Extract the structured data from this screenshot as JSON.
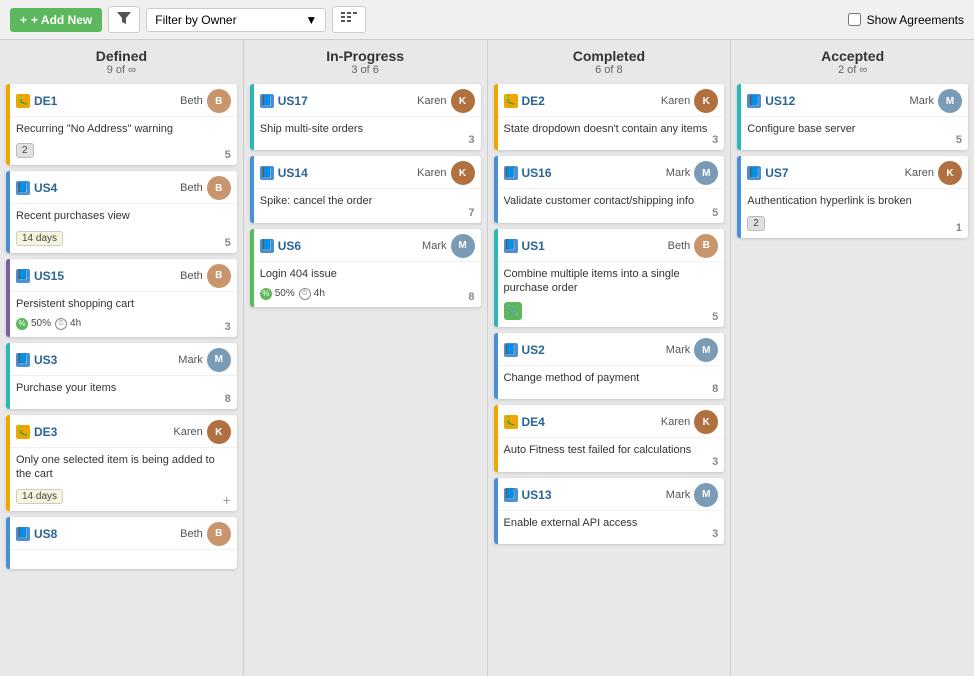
{
  "toolbar": {
    "add_new_label": "+ Add New",
    "filter_placeholder": "Filter by Owner",
    "show_agreements_label": "Show Agreements"
  },
  "columns": [
    {
      "id": "defined",
      "title": "Defined",
      "count": "9 of ∞",
      "cards": [
        {
          "id": "DE1",
          "type": "defect",
          "color": "orange",
          "owner": "Beth",
          "owner_key": "beth",
          "title": "Recurring \"No Address\" warning",
          "tags": [
            {
              "label": "2",
              "type": "badge"
            }
          ],
          "points": "5"
        },
        {
          "id": "US4",
          "type": "story",
          "color": "blue",
          "owner": "Beth",
          "owner_key": "beth",
          "title": "Recent purchases view",
          "tags": [
            {
              "label": "14 days",
              "type": "days"
            }
          ],
          "points": "5"
        },
        {
          "id": "US15",
          "type": "story",
          "color": "purple",
          "owner": "Beth",
          "owner_key": "beth",
          "title": "Persistent shopping cart",
          "tags": [
            {
              "label": "50%",
              "type": "progress"
            },
            {
              "label": "4h",
              "type": "clock"
            }
          ],
          "points": "3"
        },
        {
          "id": "US3",
          "type": "story",
          "color": "teal",
          "owner": "Mark",
          "owner_key": "mark",
          "title": "Purchase your items",
          "tags": [],
          "points": "8"
        },
        {
          "id": "DE3",
          "type": "defect",
          "color": "orange",
          "owner": "Karen",
          "owner_key": "karen",
          "title": "Only one selected item is being added to the cart",
          "tags": [
            {
              "label": "14 days",
              "type": "days"
            }
          ],
          "points": "+"
        },
        {
          "id": "US8",
          "type": "story",
          "color": "blue",
          "owner": "Beth",
          "owner_key": "beth",
          "title": "",
          "tags": [],
          "points": ""
        }
      ]
    },
    {
      "id": "in-progress",
      "title": "In-Progress",
      "count": "3 of 6",
      "cards": [
        {
          "id": "US17",
          "type": "story",
          "color": "teal",
          "owner": "Karen",
          "owner_key": "karen",
          "title": "Ship multi-site orders",
          "tags": [],
          "points": "3"
        },
        {
          "id": "US14",
          "type": "story",
          "color": "blue",
          "owner": "Karen",
          "owner_key": "karen",
          "title": "Spike: cancel the order",
          "tags": [],
          "points": "7"
        },
        {
          "id": "US6",
          "type": "story",
          "color": "green",
          "owner": "Mark",
          "owner_key": "mark",
          "title": "Login 404 issue",
          "tags": [
            {
              "label": "50%",
              "type": "progress"
            },
            {
              "label": "4h",
              "type": "clock"
            }
          ],
          "points": "8"
        }
      ]
    },
    {
      "id": "completed",
      "title": "Completed",
      "count": "6 of 8",
      "cards": [
        {
          "id": "DE2",
          "type": "defect",
          "color": "orange",
          "owner": "Karen",
          "owner_key": "karen",
          "title": "State dropdown doesn't contain any items",
          "tags": [],
          "points": "3"
        },
        {
          "id": "US16",
          "type": "story",
          "color": "blue",
          "owner": "Mark",
          "owner_key": "mark",
          "title": "Validate customer contact/shipping info",
          "tags": [],
          "points": "5"
        },
        {
          "id": "US1",
          "type": "story",
          "color": "teal",
          "owner": "Beth",
          "owner_key": "beth",
          "title": "Combine multiple items into a single purchase order",
          "tags": [
            {
              "label": "attach",
              "type": "attach"
            }
          ],
          "points": "5"
        },
        {
          "id": "US2",
          "type": "story",
          "color": "blue",
          "owner": "Mark",
          "owner_key": "mark",
          "title": "Change method of payment",
          "tags": [],
          "points": "8"
        },
        {
          "id": "DE4",
          "type": "defect",
          "color": "orange",
          "owner": "Karen",
          "owner_key": "karen",
          "title": "Auto Fitness test failed for calculations",
          "tags": [],
          "points": "3"
        },
        {
          "id": "US13",
          "type": "story",
          "color": "blue",
          "owner": "Mark",
          "owner_key": "mark",
          "title": "Enable external API access",
          "tags": [],
          "points": "3"
        }
      ]
    },
    {
      "id": "accepted",
      "title": "Accepted",
      "count": "2 of ∞",
      "cards": [
        {
          "id": "US12",
          "type": "story",
          "color": "teal",
          "owner": "Mark",
          "owner_key": "mark",
          "title": "Configure base server",
          "tags": [],
          "points": "5"
        },
        {
          "id": "US7",
          "type": "story",
          "color": "blue",
          "owner": "Karen",
          "owner_key": "karen",
          "title": "Authentication hyperlink is broken",
          "tags": [
            {
              "label": "2",
              "type": "badge"
            }
          ],
          "points": "1"
        }
      ]
    }
  ]
}
